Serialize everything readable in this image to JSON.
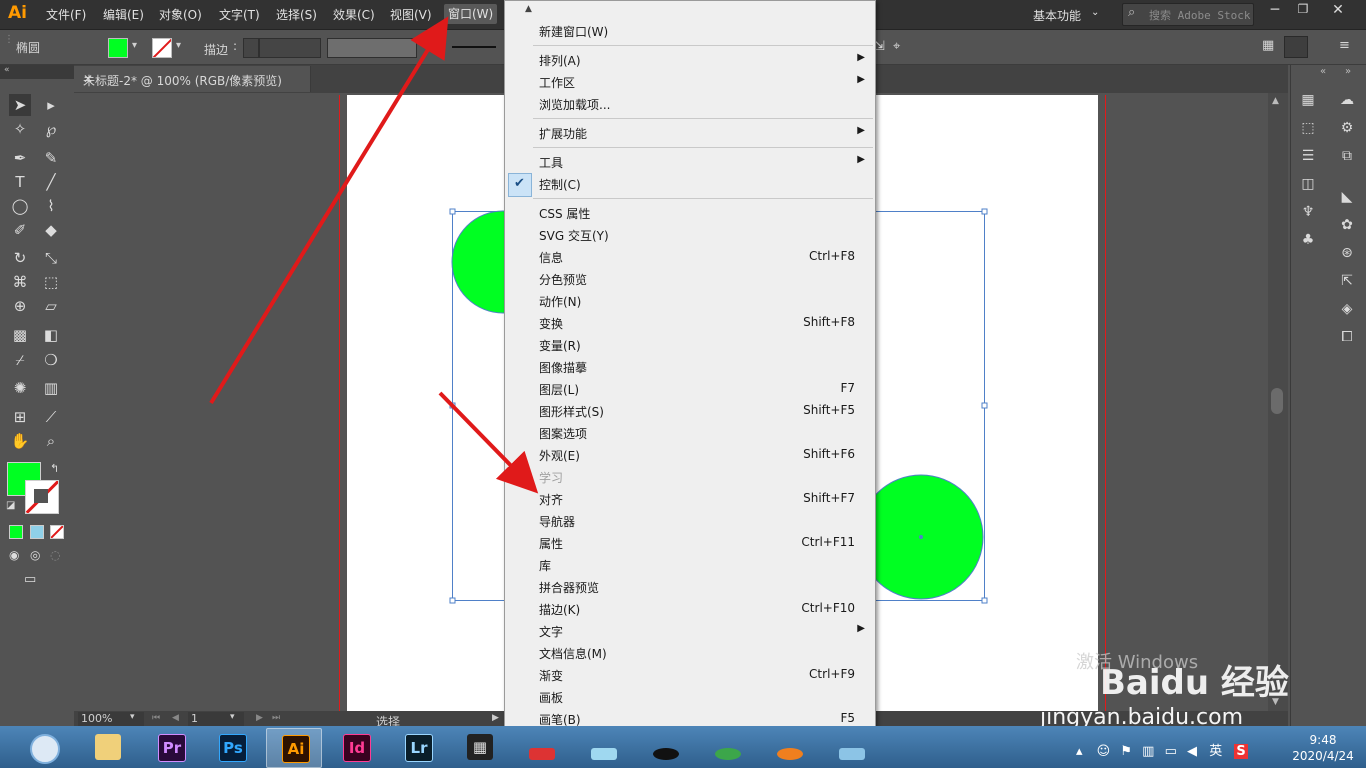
{
  "app": {
    "logo": "Ai",
    "workspace": "基本功能",
    "search_placeholder": "搜索 Adobe Stock"
  },
  "menubar": {
    "items": [
      "文件(F)",
      "编辑(E)",
      "对象(O)",
      "文字(T)",
      "选择(S)",
      "效果(C)",
      "视图(V)",
      "窗口(W)"
    ],
    "active": "窗口(W)"
  },
  "control": {
    "object_label": "椭圆",
    "stroke_label": "描边",
    "fill_color": "#00ff22"
  },
  "document": {
    "tab_title": "未标题-2* @ 100% (RGB/像素预览)"
  },
  "status": {
    "zoom": "100%",
    "page": "1",
    "text": "选择"
  },
  "menu": {
    "items": [
      {
        "label": "新建窗口(W)"
      },
      {
        "label": "排列(A)",
        "submenu": true
      },
      {
        "label": "工作区",
        "submenu": true
      },
      {
        "label": "浏览加载项..."
      },
      {
        "label": "扩展功能",
        "submenu": true
      },
      {
        "label": "工具",
        "submenu": true
      },
      {
        "label": "控制(C)",
        "checked": true
      },
      {
        "label": "CSS 属性"
      },
      {
        "label": "SVG 交互(Y)"
      },
      {
        "label": "信息",
        "shortcut": "Ctrl+F8"
      },
      {
        "label": "分色预览"
      },
      {
        "label": "动作(N)"
      },
      {
        "label": "变换",
        "shortcut": "Shift+F8"
      },
      {
        "label": "变量(R)"
      },
      {
        "label": "图像描摹"
      },
      {
        "label": "图层(L)",
        "shortcut": "F7"
      },
      {
        "label": "图形样式(S)",
        "shortcut": "Shift+F5"
      },
      {
        "label": "图案选项"
      },
      {
        "label": "外观(E)",
        "shortcut": "Shift+F6"
      },
      {
        "label": "学习",
        "disabled": true
      },
      {
        "label": "对齐",
        "shortcut": "Shift+F7"
      },
      {
        "label": "导航器"
      },
      {
        "label": "属性",
        "shortcut": "Ctrl+F11"
      },
      {
        "label": "库"
      },
      {
        "label": "拼合器预览"
      },
      {
        "label": "描边(K)",
        "shortcut": "Ctrl+F10"
      },
      {
        "label": "文字",
        "submenu": true
      },
      {
        "label": "文档信息(M)"
      },
      {
        "label": "渐变",
        "shortcut": "Ctrl+F9"
      },
      {
        "label": "画板"
      },
      {
        "label": "画笔(B)",
        "shortcut": "F5"
      }
    ]
  },
  "taskbar": {
    "apps": [
      "Pr",
      "Ps",
      "Ai",
      "Id",
      "Lr"
    ],
    "active": "Ai",
    "time": "9:48",
    "date": "2020/4/24",
    "ime": "英"
  },
  "watermark": {
    "activate": "激活 Windows",
    "site": "jingyan.baidu.com",
    "logo": "Baidu 经验"
  },
  "colors": {
    "accent_green": "#00ff22",
    "arrow_red": "#e01a1a",
    "selection_blue": "#4f80c8"
  }
}
